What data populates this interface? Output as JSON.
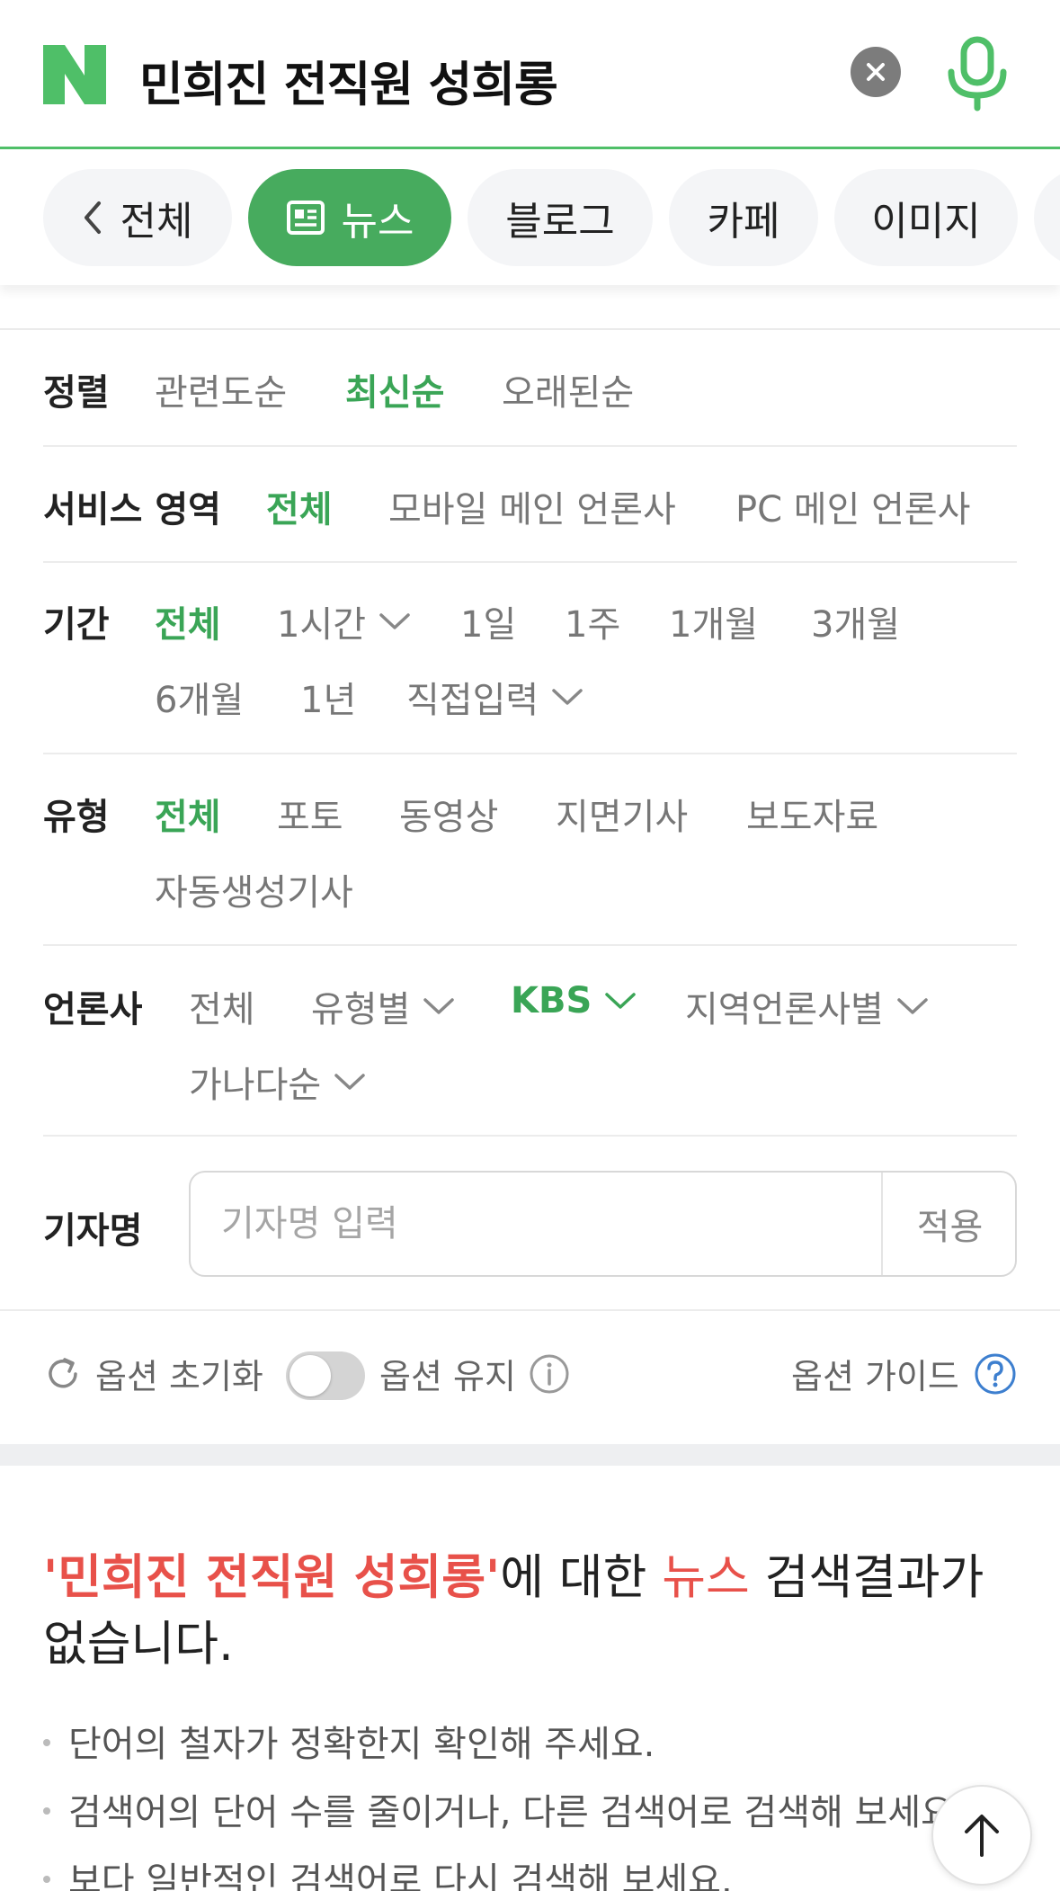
{
  "search": {
    "query": "민희진 전직원 성희롱"
  },
  "tabs": [
    {
      "label": "전체"
    },
    {
      "label": "뉴스"
    },
    {
      "label": "블로그"
    },
    {
      "label": "카페"
    },
    {
      "label": "이미지"
    }
  ],
  "options": {
    "sort": {
      "label": "정렬",
      "items": [
        "관련도순",
        "최신순",
        "오래된순"
      ],
      "selected": "최신순"
    },
    "service": {
      "label": "서비스 영역",
      "items": [
        "전체",
        "모바일 메인 언론사",
        "PC 메인 언론사"
      ],
      "selected": "전체"
    },
    "period": {
      "label": "기간",
      "items": [
        "전체",
        "1시간",
        "1일",
        "1주",
        "1개월",
        "3개월",
        "6개월",
        "1년",
        "직접입력"
      ],
      "selected": "전체"
    },
    "type": {
      "label": "유형",
      "items": [
        "전체",
        "포토",
        "동영상",
        "지면기사",
        "보도자료",
        "자동생성기사"
      ],
      "selected": "전체"
    },
    "press": {
      "label": "언론사",
      "items": [
        "전체",
        "유형별",
        "KBS",
        "지역언론사별",
        "가나다순"
      ],
      "selected": "KBS"
    },
    "reporter": {
      "label": "기자명",
      "placeholder": "기자명 입력",
      "apply": "적용"
    }
  },
  "footer_options": {
    "reset": "옵션 초기화",
    "keep": "옵션 유지",
    "guide": "옵션 가이드"
  },
  "result": {
    "query_quoted": "'민희진 전직원 성희롱'",
    "mid": "에 대한 ",
    "section": "뉴스",
    "tail": " 검색결과가 없습니다.",
    "tips": [
      "단어의 철자가 정확한지 확인해 주세요.",
      "검색어의 단어 수를 줄이거나, 다른 검색어로 검색해 보세요.",
      "보다 일반적인 검색어로 다시 검색해 보세요."
    ]
  },
  "colors": {
    "brand": "#4fbf68",
    "active_tab": "#47ab5e",
    "selected_option": "#3aa556",
    "highlight": "#e8514a"
  }
}
